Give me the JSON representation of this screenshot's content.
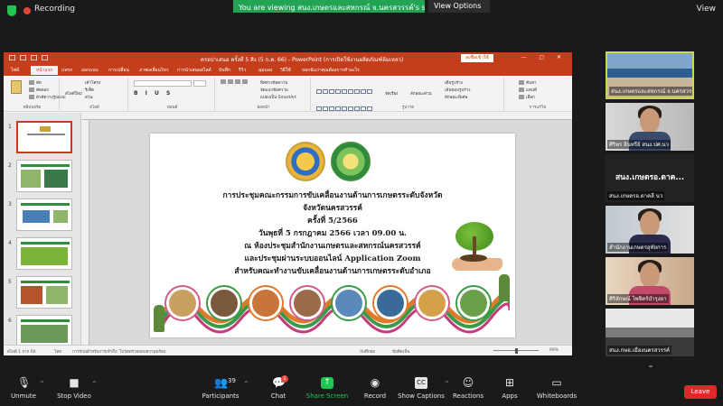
{
  "topbar": {
    "recording": "Recording",
    "viewing": "You are viewing สนง.เกษตรและสหกรณ์ จ.นครสวรรค์'s screen",
    "view_options": "View Options",
    "view": "View"
  },
  "powerpoint": {
    "doc_title": "ครอบ่าเสนอ ครั้งที่ 5 สิง (5 ก.ค. 66) - PowerPoint (การเปิดใช้งานผลิตภัณฑ์ล้มเหลว)",
    "sign_in": "ลงชื่อเข้าใช้",
    "tabs": [
      "ไฟล์",
      "หน้าแรก",
      "แทรก",
      "ออกแบบ",
      "การเปลี่ยน",
      "ภาพเคลื่อนไหว",
      "การนำเสนอสไลด์",
      "บันทึก",
      "รีวิว",
      "มุมมอง",
      "วิธีใช้",
      "บอกฉันว่าคุณต้องการทำอะไร"
    ],
    "ribbon": {
      "clipboard_label": "คลิปบอร์ด",
      "cut": "ตัด",
      "copy": "คัดลอก",
      "format_painter": "ตัวคัดวางรูปแบบ",
      "new_slide": "สไลด์ใหม่",
      "reuse": "นำสไลด์มาใช้ใหม่",
      "layout": "เค้าโครง",
      "reset": "รีเซ็ต",
      "section": "ส่วน",
      "slides_label": "สไลด์",
      "font_label": "ฟอนต์",
      "paragraph_label": "ย่อหน้า",
      "text_direction": "ทิศทางข้อความ",
      "align_text": "จัดแนวข้อความ",
      "smartart": "แปลงเป็น SmartArt",
      "drawing_label": "รูปวาด",
      "arrange": "จัดเรียง",
      "quick_styles": "ลักษณะด่วน",
      "shape_fill": "เติมรูปร่าง",
      "shape_outline": "เส้นขอบรูปร่าง",
      "shape_effects": "ลักษณะพิเศษ",
      "find": "ค้นหา",
      "replace": "แทนที่",
      "select": "เลือก",
      "editing_label": "การแก้ไข"
    },
    "slide": {
      "line1": "การประชุมคณะกรรมการขับเคลื่อนงานด้านการเกษตรระดับจังหวัด",
      "line2": "จังหวัดนครสวรรค์",
      "line3": "ครั้งที่ 5/2566",
      "line4": "วันพุธที่ 5 กรกฎาคม 2566 เวลา 09.00 น.",
      "line5": "ณ ห้องประชุมสำนักงานเกษตรและสหกรณ์นครสวรรค์",
      "line6": "และประชุมผ่านระบบออนไลน์ Application Zoom",
      "line7": "สำหรับคณะทำงานขับเคลื่อนงานด้านการเกษตรระดับอำเภอ"
    },
    "thumb_numbers": [
      "1",
      "2",
      "3",
      "4",
      "5",
      "6"
    ],
    "status": {
      "slide_info": "สไลด์ 1 จาก 60",
      "language": "ไทย",
      "notes_hint": "การช่วยสำหรับการเข้าถึง: โปรดตรวจสอบความพร้อม",
      "notes": "บันทึกย่อ",
      "comments": "ข้อคิดเห็น",
      "zoom": "69%"
    }
  },
  "gallery": [
    {
      "name": "สนง.เกษตรและสหกรณ์ จ.นครสวรรค์",
      "type": "room"
    },
    {
      "name": "ศิริพร อินทรีย์ สนง.ปศ.นว",
      "type": "person"
    },
    {
      "name": "สนง.เกษตรอ.ตาคลี นว",
      "type": "text",
      "big": "สนง.เกษตรอ.ตาค..."
    },
    {
      "name": "สำนักงานเกษตรอุทัยการ",
      "type": "person"
    },
    {
      "name": "ศิริลักษณ์ ไพจิตร์บำรุงยา",
      "type": "person"
    },
    {
      "name": "สนง.กษอ.เมืองนครสวรรค์",
      "type": "room"
    }
  ],
  "toolbar": {
    "unmute": "Unmute",
    "stop_video": "Stop Video",
    "participants": "Participants",
    "participants_count": "39",
    "chat": "Chat",
    "chat_badge": "1",
    "share_screen": "Share Screen",
    "record": "Record",
    "show_captions": "Show Captions",
    "reactions": "Reactions",
    "apps": "Apps",
    "whiteboards": "Whiteboards",
    "leave": "Leave"
  },
  "colors": {
    "ppt_accent": "#c43e1c",
    "zoom_green": "#23a455",
    "leave_red": "#e02828"
  }
}
